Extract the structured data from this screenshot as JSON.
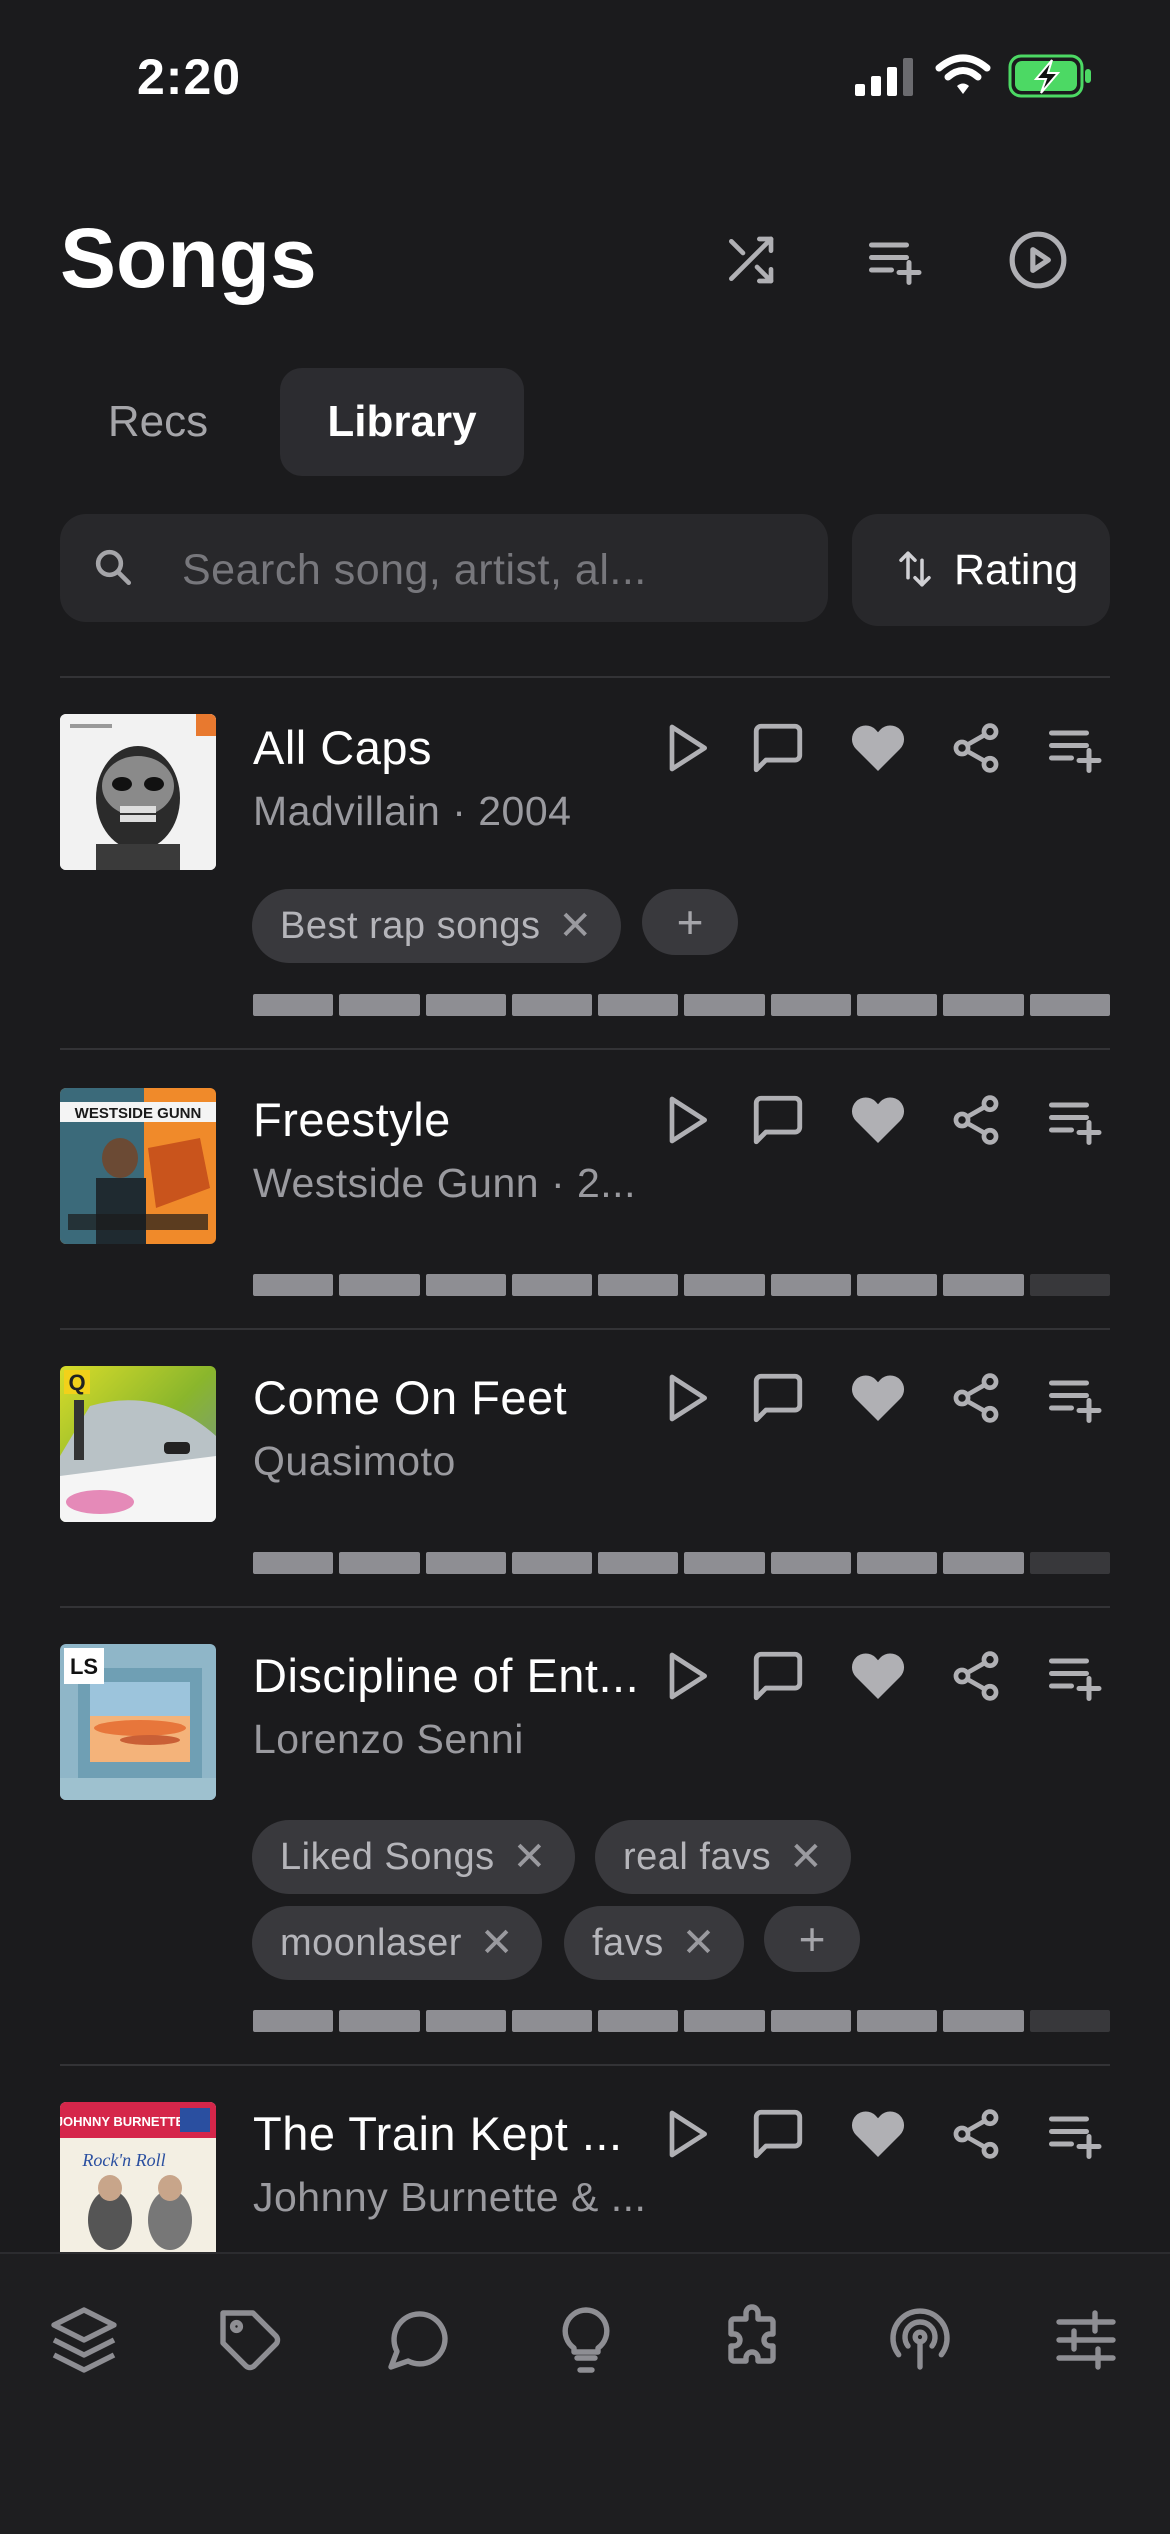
{
  "status_bar": {
    "time": "2:20"
  },
  "header": {
    "title": "Songs"
  },
  "tabs": [
    {
      "label": "Recs",
      "selected": false
    },
    {
      "label": "Library",
      "selected": true
    }
  ],
  "search": {
    "placeholder": "Search song, artist, al..."
  },
  "sort": {
    "label": "Rating"
  },
  "colors": {
    "background": "#1b1b1d",
    "surface": "#28282b",
    "selected_tab": "#2c2c30",
    "rating_on": "#8e8e93",
    "rating_off": "#38383b",
    "icon": "#b0b0b4"
  },
  "songs": [
    {
      "title": "All Caps",
      "subtitle": "Madvillain · 2004",
      "tags": [
        {
          "label": "Best rap songs"
        }
      ],
      "rating": {
        "filled": 10,
        "total": 10
      }
    },
    {
      "title": "Freestyle",
      "subtitle": "Westside Gunn · 2...",
      "tags": [],
      "rating": {
        "filled": 9,
        "total": 10
      }
    },
    {
      "title": "Come On Feet",
      "subtitle": "Quasimoto",
      "tags": [],
      "rating": {
        "filled": 9,
        "total": 10
      }
    },
    {
      "title": "Discipline of Ent...",
      "subtitle": "Lorenzo Senni",
      "tags": [
        {
          "label": "Liked Songs"
        },
        {
          "label": "real favs"
        },
        {
          "label": "moonlaser"
        },
        {
          "label": "favs"
        }
      ],
      "rating": {
        "filled": 9,
        "total": 10
      }
    },
    {
      "title": "The Train Kept ...",
      "subtitle": "Johnny Burnette & ...",
      "tags": [],
      "album_art_text": {
        "line1": "JOHNNY BURNETTE",
        "line2": "Rock'n Roll"
      }
    }
  ],
  "row_actions": [
    "play-icon",
    "comment-icon",
    "heart-icon",
    "share-icon",
    "add-to-queue-icon"
  ],
  "chip_actions": {
    "remove_glyph": "✕",
    "add_glyph": "+"
  },
  "bottom_nav": [
    "layers-icon",
    "tag-icon",
    "chat-icon",
    "lightbulb-icon",
    "puzzle-icon",
    "podcast-icon",
    "sliders-icon"
  ]
}
